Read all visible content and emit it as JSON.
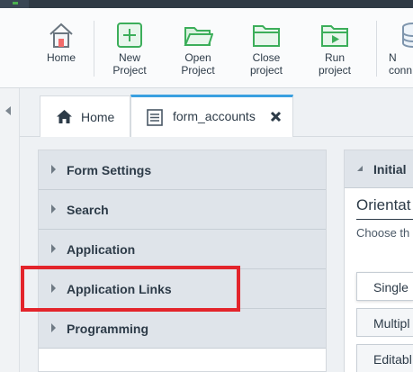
{
  "toolbar": {
    "buttons": [
      {
        "label": "Home",
        "icon": "home-icon"
      },
      {
        "label": "New\nProject",
        "icon": "new-project-icon"
      },
      {
        "label": "Open\nProject",
        "icon": "open-folder-icon"
      },
      {
        "label": "Close\nproject",
        "icon": "close-folder-icon"
      },
      {
        "label": "Run\nproject",
        "icon": "run-folder-icon"
      },
      {
        "label": "N\nconn",
        "icon": "database-icon"
      }
    ]
  },
  "tabs": [
    {
      "label": "Home",
      "icon": "home-icon"
    },
    {
      "label": "form_accounts",
      "icon": "form-icon",
      "active": true
    }
  ],
  "accordion": {
    "items": [
      {
        "label": "Form Settings"
      },
      {
        "label": "Search"
      },
      {
        "label": "Application"
      },
      {
        "label": "Application Links",
        "highlighted": true
      },
      {
        "label": "Programming"
      }
    ]
  },
  "right_panel": {
    "header": "Initial",
    "title": "Orientat",
    "subtitle": "Choose th",
    "options": [
      {
        "label": "Single",
        "selected": true
      },
      {
        "label": "Multipl"
      },
      {
        "label": "Editabl"
      }
    ]
  },
  "colors": {
    "accent_green": "#3cae5a",
    "tab_active_border": "#3aa0e0",
    "highlight_red": "#e3242b",
    "accordion_bg": "#dfe4ea"
  }
}
